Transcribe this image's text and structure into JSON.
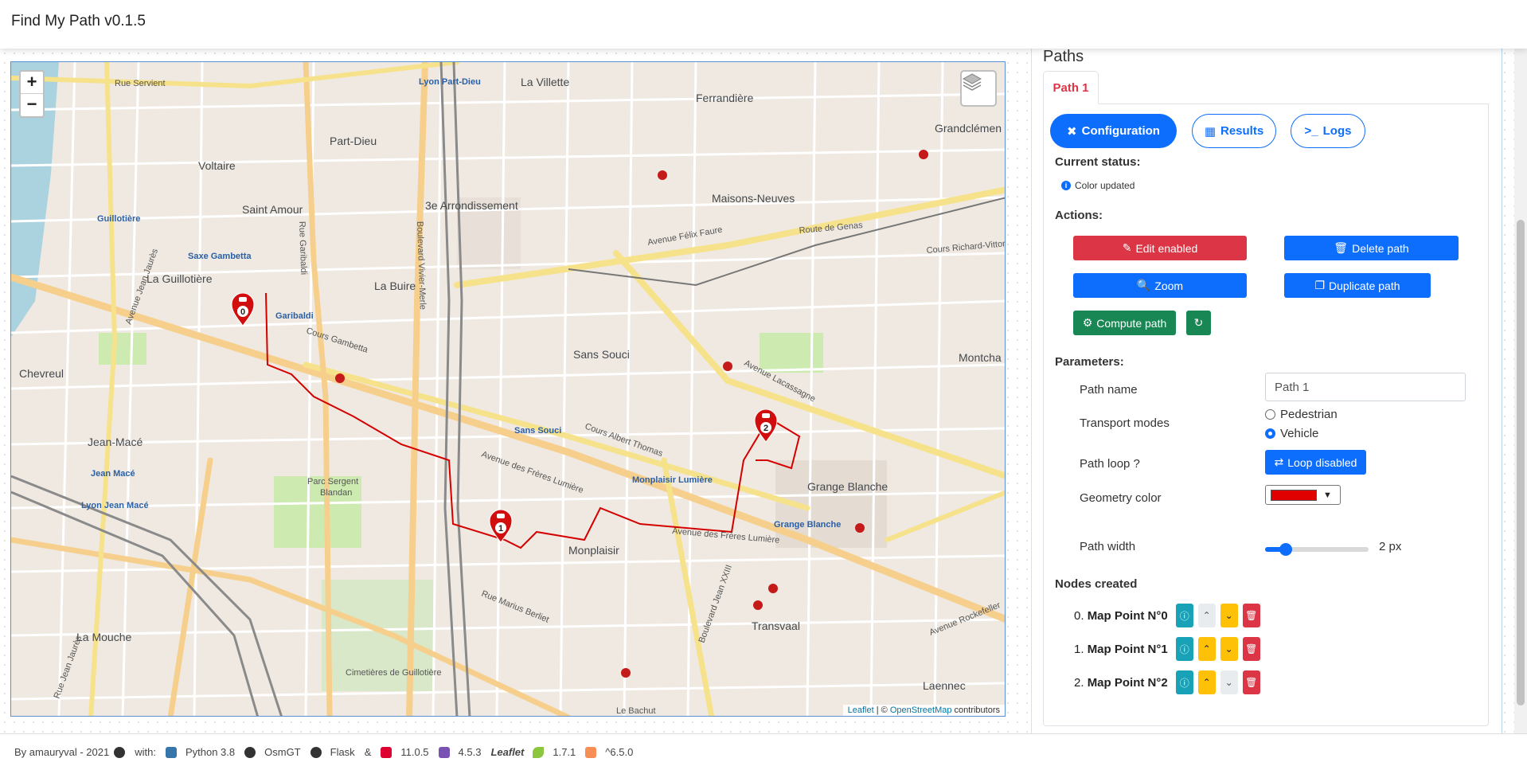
{
  "app": {
    "title": "Find My Path v0.1.5"
  },
  "map": {
    "zoom_in": "+",
    "zoom_out": "−",
    "attribution": {
      "leaflet": "Leaflet",
      "sep": " | © ",
      "osm": "OpenStreetMap",
      "suffix": " contributors"
    },
    "markers": [
      "0",
      "1",
      "2"
    ],
    "labels": {
      "part_dieu": "Part-Dieu",
      "arr3": "3e Arrondissement",
      "maisons_neuves": "Maisons-Neuves",
      "ferrandiere": "Ferrandière",
      "la_villette": "La Villette",
      "sans_souci": "Sans Souci",
      "monplaisir": "Monplaisir",
      "jean_mace": "Jean-Macé",
      "la_guillotiere": "La Guillotière",
      "grange_blanche": "Grange Blanche",
      "transvaal": "Transvaal",
      "la_mouche": "La Mouche",
      "voltaire": "Voltaire",
      "saint_amour": "Saint Amour",
      "la_buire": "La Buire",
      "chevreul": "Chevreul",
      "parc_sergent": "Parc Sergent Blandan",
      "cimetieres": "Cimetières de Guillotière",
      "laennec": "Laennec",
      "grandclement": "Grandclémen",
      "montchat": "Montcha",
      "cours_gambetta": "Cours Gambetta",
      "cours_albert_thomas": "Cours Albert Thomas",
      "av_freres_lumiere": "Avenue des Frères Lumière",
      "av_lacassagne": "Avenue Lacassagne",
      "route_genas": "Route de Genas",
      "av_felix_faure": "Avenue Félix Faure",
      "rue_garibaldi": "Rue Garibaldi",
      "bd_vivier_merle": "Boulevard Vivier-Merle",
      "rue_marius_berliet": "Rue Marius Berliet",
      "av_jean_jaures": "Avenue Jean Jaurès",
      "bd_jean_xxiii": "Boulevard Jean XXIII",
      "cours_richard": "Cours Richard-Vitton",
      "av_rockefeller": "Avenue Rockefeller",
      "rue_servient": "Rue Servient",
      "lyon_part_dieu": "Lyon Part-Dieu",
      "jean_mace_st": "Jean Macé",
      "lyon_jean_mace": "Lyon Jean Macé",
      "guillotiere_st": "Guillotière",
      "saxe_gambetta": "Saxe Gambetta",
      "monplaisir_lumiere": "Monplaisir Lumière",
      "sans_souci_st": "Sans Souci",
      "grange_blanche_st": "Grange Blanche",
      "garibaldi_st": "Garibaldi",
      "rue_jean_jaures": "Rue Jean Jaurès",
      "le_bachut": "Le Bachut"
    }
  },
  "panel": {
    "heading": "Paths",
    "tab": "Path 1",
    "pills": {
      "configuration": "Configuration",
      "results": "Results",
      "logs": "Logs"
    },
    "status_label": "Current status:",
    "status_text": "Color updated",
    "actions_label": "Actions:",
    "buttons": {
      "edit": "Edit enabled",
      "delete": "Delete path",
      "zoom": "Zoom",
      "duplicate": "Duplicate path",
      "compute": "Compute path",
      "refresh": "↻"
    },
    "parameters_label": "Parameters:",
    "path_name_label": "Path name",
    "path_name_value": "Path 1",
    "transport_label": "Transport modes",
    "transport_options": [
      "Pedestrian",
      "Vehicle"
    ],
    "transport_selected": "Vehicle",
    "loop_label": "Path loop ?",
    "loop_button": "Loop disabled",
    "color_label": "Geometry color",
    "color_value": "#e00000",
    "width_label": "Path width",
    "width_value": "2 px",
    "width_fraction": 0.2,
    "nodes_label": "Nodes created",
    "nodes": [
      {
        "index": "0.",
        "name": "Map Point N°0"
      },
      {
        "index": "1.",
        "name": "Map Point N°1"
      },
      {
        "index": "2.",
        "name": "Map Point N°2"
      }
    ]
  },
  "footer": {
    "by": "By amauryval - 2021",
    "with": "with:",
    "python": "Python 3.8",
    "osmgt": "OsmGT",
    "flask": "Flask",
    "amp": "&",
    "angular": "11.0.5",
    "bootstrap": "4.5.3",
    "leaflet": "Leaflet",
    "leaflet_ver": "1.7.1",
    "d3": "^6.5.0"
  },
  "colors": {
    "primary": "#0d6efd",
    "danger": "#dc3545",
    "success": "#198754",
    "warning": "#ffc107",
    "info": "#17a2b8",
    "route": "#d40000"
  }
}
